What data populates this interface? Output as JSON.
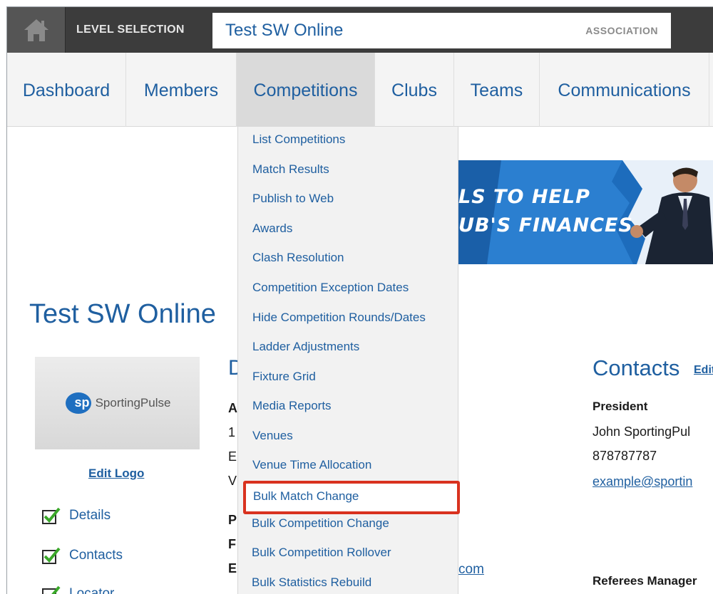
{
  "topbar": {
    "home_icon": "home-icon",
    "level_label": "LEVEL SELECTION",
    "level_name": "Test SW Online",
    "level_type": "ASSOCIATION"
  },
  "nav": {
    "items": [
      "Dashboard",
      "Members",
      "Competitions",
      "Clubs",
      "Teams",
      "Communications"
    ],
    "active": "Competitions"
  },
  "dropdown": {
    "items": [
      "List Competitions",
      "Match Results",
      "Publish to Web",
      "Awards",
      "Clash Resolution",
      "Competition Exception Dates",
      "Hide Competition Rounds/Dates",
      "Ladder Adjustments",
      "Fixture Grid",
      "Media Reports",
      "Venues",
      "Venue Time Allocation",
      "Bulk Match Change",
      "Bulk Competition Change",
      "Bulk Competition Rollover",
      "Bulk Statistics Rebuild"
    ],
    "highlighted": "Bulk Match Change"
  },
  "banner": {
    "line1": "LS TO HELP",
    "line2": "UB'S FINANCES"
  },
  "main": {
    "title": "Test SW Online",
    "logo_text": "SportingPulse",
    "logo_mark": "sp",
    "edit_logo": "Edit Logo",
    "checklist": [
      "Details",
      "Contacts",
      "Locator"
    ],
    "details_heading_fragment": "D",
    "address_fragments": [
      "A",
      "1",
      "E",
      "V"
    ],
    "phone_fragments": [
      "P",
      "F",
      "E"
    ],
    "email_tail": "com"
  },
  "contacts": {
    "title": "Contacts",
    "edit": "Edit",
    "role1": "President",
    "name1": "John SportingPul",
    "phone1": "878787787",
    "email1": "example@sportin",
    "role2": "Referees Manager"
  },
  "colors": {
    "link_blue": "#1f5fa0",
    "highlight_red": "#d9321f",
    "topbar": "#3c3c3c",
    "check_green": "#3aa829"
  }
}
